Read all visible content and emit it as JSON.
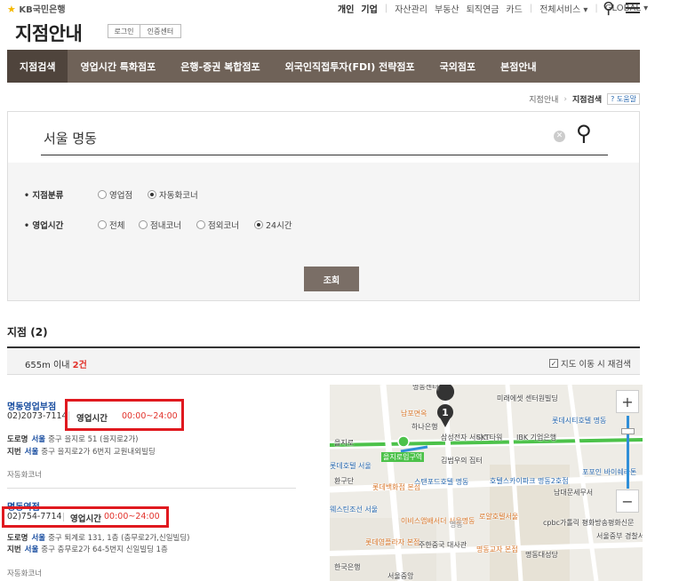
{
  "header": {
    "logo": "KB국민은행",
    "nav": [
      "개인",
      "기업",
      "자산관리",
      "부동산",
      "퇴직연금",
      "카드",
      "전체서비스 ▾",
      "GLOBAL ▾"
    ],
    "page_title": "지점안내",
    "login_label": "로그인",
    "cert_label": "인증센터"
  },
  "main_nav": [
    "지점검색",
    "영업시간 특화점포",
    "은행-증권 복합점포",
    "외국인직접투자(FDI) 전략점포",
    "국외점포",
    "본점안내"
  ],
  "breadcrumb": {
    "parent": "지점안내",
    "current": "지점검색",
    "help": "? 도움말"
  },
  "search": {
    "query": "서울 명동",
    "branch_type_label": "• 지점분류",
    "branch_types": [
      {
        "label": "영업점",
        "selected": false
      },
      {
        "label": "자동화코너",
        "selected": true
      }
    ],
    "hours_label": "• 영업시간",
    "hours_options": [
      {
        "label": "전체",
        "selected": false
      },
      {
        "label": "점내코너",
        "selected": false
      },
      {
        "label": "점외코너",
        "selected": false
      },
      {
        "label": "24시간",
        "selected": true
      }
    ],
    "submit_label": "조회"
  },
  "results": {
    "title": "지점 (2)",
    "range_prefix": "655m 이내",
    "count": "2건",
    "map_checkbox_label": "지도 이동 시 재검색",
    "items": [
      {
        "name": "명동영업부점",
        "phone": "02)2073-7114",
        "hours_label": "영업시간",
        "hours": "00:00~24:00",
        "road_label": "도로명",
        "road_city": "서울",
        "road_addr": "중구 을지로 51 (을지로2가)",
        "lot_label": "지번",
        "lot_city": "서울",
        "lot_addr": "중구 을지로2가 6번지 교원내외빌딩",
        "tag": "자동화코너"
      },
      {
        "name": "명동역점",
        "phone": "02)754-7714",
        "hours_label": "영업시간",
        "hours": "00:00~24:00",
        "road_label": "도로명",
        "road_city": "서울",
        "road_addr": "중구 퇴계로 131, 1층 (충무로2가,신일빌딩)",
        "lot_label": "지번",
        "lot_city": "서울",
        "lot_addr": "중구 충무로2가 64-5번지 신일빌딩 1층",
        "tag": "자동화코너"
      }
    ]
  },
  "map": {
    "marker_number": "1",
    "labels": [
      "명동센터",
      "미래에셋 센터원빌딩",
      "남포면옥",
      "하나은행",
      "롯데시티호텔 명동",
      "을지로",
      "삼성전자 서비스",
      "SKT타워",
      "IBK 기업은행",
      "을지로입구역",
      "김범우의 집터",
      "롯데호텔 서울",
      "환구단",
      "롯데백화점 본점",
      "스탠포드호텔 명동",
      "호텔스카이파크 명동2호점",
      "남대문세무서",
      "포포인 바이쉐라톤",
      "웨스틴조선 서울",
      "이비스앰배서더 서울명동",
      "명동",
      "로얄호텔서울",
      "cpbc가톨릭 평화방송평화신문",
      "서울중부 경찰서",
      "롯데영플라자 본점",
      "주한중국 대사관",
      "명동교자 본점",
      "명동대성당",
      "한국은행",
      "서울중앙"
    ]
  }
}
